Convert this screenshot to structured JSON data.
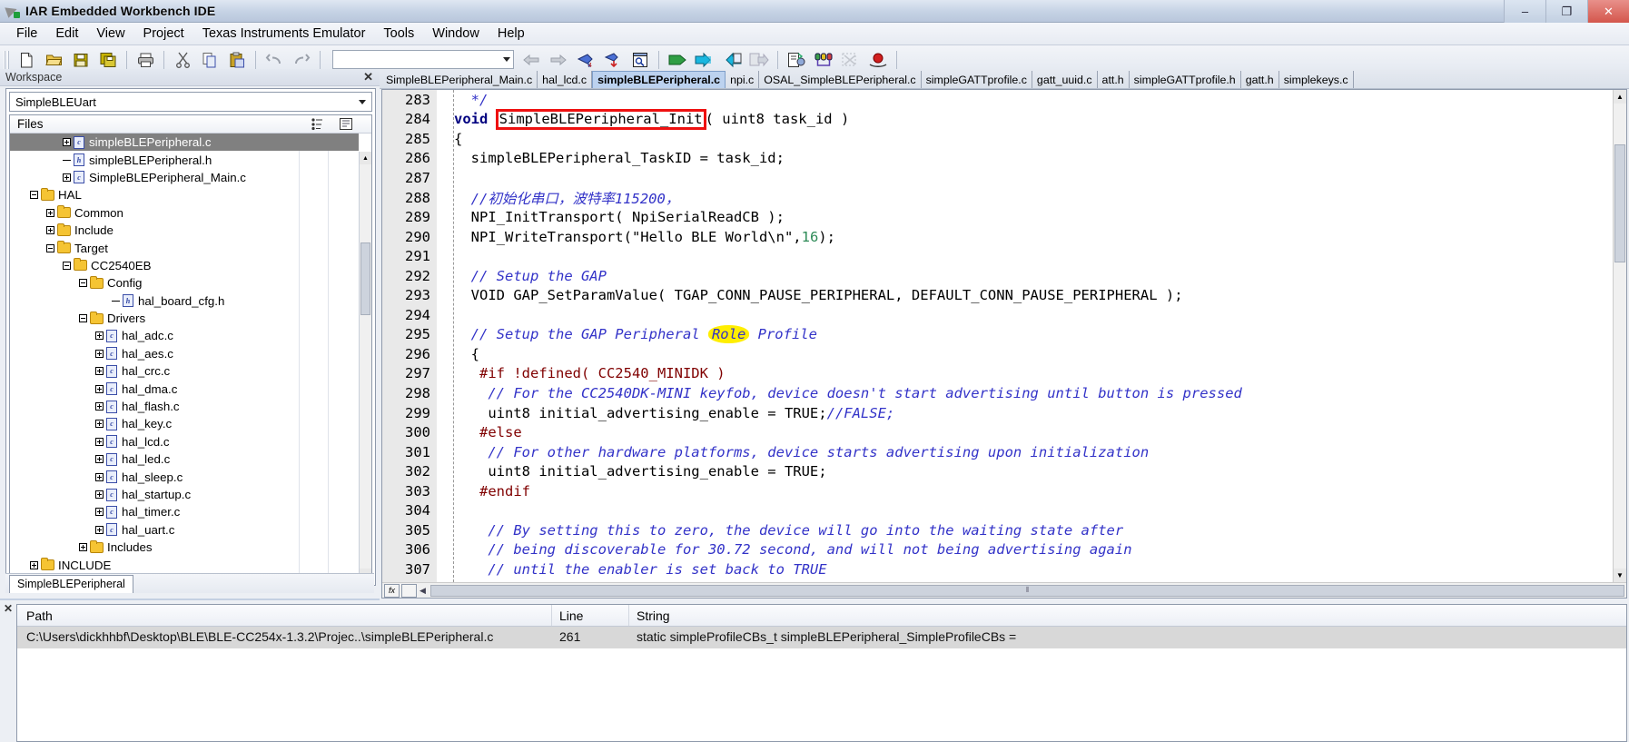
{
  "window": {
    "title": "IAR Embedded Workbench IDE",
    "icon": "app-icon",
    "buttons": {
      "minimize": "–",
      "maximize": "❐",
      "close": "✕"
    }
  },
  "menubar": {
    "items": [
      "File",
      "Edit",
      "View",
      "Project",
      "Texas Instruments Emulator",
      "Tools",
      "Window",
      "Help"
    ]
  },
  "toolbar": {
    "combo_value": "",
    "buttons": [
      "new-document-icon",
      "open-folder-icon",
      "save-icon",
      "save-all-icon",
      "print-icon",
      "cut-icon",
      "copy-icon",
      "paste-icon",
      "undo-icon",
      "redo-icon"
    ],
    "buttons2": [
      "navigate-back-icon",
      "navigate-forward-icon",
      "bookmark-toggle-icon",
      "bookmark-next-icon",
      "find-in-files-icon",
      "compile-icon",
      "make-icon",
      "stop-build-icon",
      "debug-icon",
      "debug-without-download-icon",
      "step-config-icon",
      "breakpoints-icon",
      "toggle-breakpoint-icon",
      "record-icon"
    ]
  },
  "workspace": {
    "header_title": "Workspace",
    "close_label": "✕",
    "project_combo": "SimpleBLEUart",
    "files_column": "Files",
    "footer_tab": "SimpleBLEPeripheral",
    "tree": [
      {
        "label": "simpleBLEPeripheral.c",
        "indent": 3,
        "icon": "c-file-icon",
        "expander": "plus",
        "selected": true
      },
      {
        "label": "simpleBLEPeripheral.h",
        "indent": 3,
        "icon": "h-file-icon",
        "expander": "none",
        "selected": false
      },
      {
        "label": "SimpleBLEPeripheral_Main.c",
        "indent": 3,
        "icon": "c-file-icon",
        "expander": "plus",
        "selected": false
      },
      {
        "label": "HAL",
        "indent": 1,
        "icon": "folder-icon",
        "expander": "minus",
        "selected": false
      },
      {
        "label": "Common",
        "indent": 2,
        "icon": "folder-icon",
        "expander": "plus",
        "selected": false
      },
      {
        "label": "Include",
        "indent": 2,
        "icon": "folder-icon",
        "expander": "plus",
        "selected": false
      },
      {
        "label": "Target",
        "indent": 2,
        "icon": "folder-icon",
        "expander": "minus",
        "selected": false
      },
      {
        "label": "CC2540EB",
        "indent": 3,
        "icon": "folder-icon",
        "expander": "minus",
        "selected": false
      },
      {
        "label": "Config",
        "indent": 4,
        "icon": "folder-icon",
        "expander": "minus",
        "selected": false
      },
      {
        "label": "hal_board_cfg.h",
        "indent": 6,
        "icon": "h-file-icon",
        "expander": "none",
        "selected": false
      },
      {
        "label": "Drivers",
        "indent": 4,
        "icon": "folder-icon",
        "expander": "minus",
        "selected": false
      },
      {
        "label": "hal_adc.c",
        "indent": 5,
        "icon": "c-file-icon",
        "expander": "plus",
        "selected": false
      },
      {
        "label": "hal_aes.c",
        "indent": 5,
        "icon": "c-file-icon",
        "expander": "plus",
        "selected": false
      },
      {
        "label": "hal_crc.c",
        "indent": 5,
        "icon": "c-file-icon",
        "expander": "plus",
        "selected": false
      },
      {
        "label": "hal_dma.c",
        "indent": 5,
        "icon": "c-file-icon",
        "expander": "plus",
        "selected": false
      },
      {
        "label": "hal_flash.c",
        "indent": 5,
        "icon": "c-file-icon",
        "expander": "plus",
        "selected": false
      },
      {
        "label": "hal_key.c",
        "indent": 5,
        "icon": "c-file-icon",
        "expander": "plus",
        "selected": false
      },
      {
        "label": "hal_lcd.c",
        "indent": 5,
        "icon": "c-file-icon",
        "expander": "plus",
        "selected": false
      },
      {
        "label": "hal_led.c",
        "indent": 5,
        "icon": "c-file-icon",
        "expander": "plus",
        "selected": false
      },
      {
        "label": "hal_sleep.c",
        "indent": 5,
        "icon": "c-file-icon",
        "expander": "plus",
        "selected": false
      },
      {
        "label": "hal_startup.c",
        "indent": 5,
        "icon": "c-file-icon",
        "expander": "plus",
        "selected": false
      },
      {
        "label": "hal_timer.c",
        "indent": 5,
        "icon": "c-file-icon",
        "expander": "plus",
        "selected": false
      },
      {
        "label": "hal_uart.c",
        "indent": 5,
        "icon": "c-file-icon",
        "expander": "plus",
        "selected": false
      },
      {
        "label": "Includes",
        "indent": 4,
        "icon": "folder-icon",
        "expander": "plus",
        "selected": false
      },
      {
        "label": "INCLUDE",
        "indent": 1,
        "icon": "folder-icon",
        "expander": "plus",
        "selected": false
      }
    ]
  },
  "editor": {
    "tabs": [
      {
        "label": "SimpleBLEPeripheral_Main.c",
        "active": false
      },
      {
        "label": "hal_lcd.c",
        "active": false
      },
      {
        "label": "simpleBLEPeripheral.c",
        "active": true
      },
      {
        "label": "npi.c",
        "active": false
      },
      {
        "label": "OSAL_SimpleBLEPeripheral.c",
        "active": false
      },
      {
        "label": "simpleGATTprofile.c",
        "active": false
      },
      {
        "label": "gatt_uuid.c",
        "active": false
      },
      {
        "label": "att.h",
        "active": false
      },
      {
        "label": "simpleGATTprofile.h",
        "active": false
      },
      {
        "label": "gatt.h",
        "active": false
      },
      {
        "label": "simplekeys.c",
        "active": false
      }
    ],
    "lines": [
      {
        "num": "283",
        "tokens": [
          {
            "t": "  */",
            "c": "c-com"
          }
        ]
      },
      {
        "num": "284",
        "tokens": [
          {
            "t": "void ",
            "c": "c-kw"
          },
          {
            "t": "SimpleBLEPeripheral_Init",
            "c": "c-plain",
            "box": true
          },
          {
            "t": "( uint8 task_id )",
            "c": "c-plain"
          }
        ]
      },
      {
        "num": "285",
        "tokens": [
          {
            "t": "{",
            "c": "c-plain"
          }
        ]
      },
      {
        "num": "286",
        "tokens": [
          {
            "t": "  simpleBLEPeripheral_TaskID = task_id;",
            "c": "c-plain"
          }
        ]
      },
      {
        "num": "287",
        "tokens": [
          {
            "t": "",
            "c": "c-plain"
          }
        ]
      },
      {
        "num": "288",
        "tokens": [
          {
            "t": "  //初始化串口，波特率115200，",
            "c": "c-com"
          }
        ]
      },
      {
        "num": "289",
        "tokens": [
          {
            "t": "  NPI_InitTransport( NpiSerialReadCB );",
            "c": "c-plain"
          }
        ]
      },
      {
        "num": "290",
        "tokens": [
          {
            "t": "  NPI_WriteTransport(\"Hello BLE World\\n\",",
            "c": "c-plain"
          },
          {
            "t": "16",
            "c": "c-num"
          },
          {
            "t": ");",
            "c": "c-plain"
          }
        ]
      },
      {
        "num": "291",
        "tokens": [
          {
            "t": "",
            "c": "c-plain"
          }
        ]
      },
      {
        "num": "292",
        "tokens": [
          {
            "t": "  // Setup the GAP",
            "c": "c-com"
          }
        ]
      },
      {
        "num": "293",
        "tokens": [
          {
            "t": "  VOID GAP_SetParamValue( TGAP_CONN_PAUSE_PERIPHERAL, DEFAULT_CONN_PAUSE_PERIPHERAL );",
            "c": "c-plain"
          }
        ]
      },
      {
        "num": "294",
        "tokens": [
          {
            "t": "",
            "c": "c-plain"
          }
        ]
      },
      {
        "num": "295",
        "tokens": [
          {
            "t": "  // Setup the GAP Peripheral ",
            "c": "c-com"
          },
          {
            "t": "Role",
            "c": "c-com",
            "highlight": true
          },
          {
            "t": " Profile",
            "c": "c-com"
          }
        ]
      },
      {
        "num": "296",
        "tokens": [
          {
            "t": "  {",
            "c": "c-plain"
          }
        ]
      },
      {
        "num": "297",
        "tokens": [
          {
            "t": "   #if !defined( CC2540_MINIDK )",
            "c": "c-pp"
          }
        ]
      },
      {
        "num": "298",
        "tokens": [
          {
            "t": "    // For the CC2540DK-MINI keyfob, device doesn't start advertising until button is pressed",
            "c": "c-com"
          }
        ]
      },
      {
        "num": "299",
        "tokens": [
          {
            "t": "    uint8 initial_advertising_enable = TRUE;",
            "c": "c-plain"
          },
          {
            "t": "//FALSE;",
            "c": "c-com"
          }
        ]
      },
      {
        "num": "300",
        "tokens": [
          {
            "t": "   #else",
            "c": "c-pp"
          }
        ]
      },
      {
        "num": "301",
        "tokens": [
          {
            "t": "    // For other hardware platforms, device starts advertising upon initialization",
            "c": "c-com"
          }
        ]
      },
      {
        "num": "302",
        "tokens": [
          {
            "t": "    uint8 initial_advertising_enable = TRUE;",
            "c": "c-plain"
          }
        ]
      },
      {
        "num": "303",
        "tokens": [
          {
            "t": "   #endif",
            "c": "c-pp"
          }
        ]
      },
      {
        "num": "304",
        "tokens": [
          {
            "t": "",
            "c": "c-plain"
          }
        ]
      },
      {
        "num": "305",
        "tokens": [
          {
            "t": "    // By setting this to zero, the device will go into the waiting state after",
            "c": "c-com"
          }
        ]
      },
      {
        "num": "306",
        "tokens": [
          {
            "t": "    // being discoverable for 30.72 second, and will not being advertising again",
            "c": "c-com"
          }
        ]
      },
      {
        "num": "307",
        "tokens": [
          {
            "t": "    // until the enabler is set back to TRUE",
            "c": "c-com"
          }
        ]
      }
    ],
    "hscroll_grip": "⦀",
    "fx_button": "fx"
  },
  "findpanel": {
    "close_label": "✕",
    "columns": [
      "Path",
      "Line",
      "String"
    ],
    "rows": [
      {
        "path": "C:\\Users\\dickhhbf\\Desktop\\BLE\\BLE-CC254x-1.3.2\\Projec..\\simpleBLEPeripheral.c",
        "line": "261",
        "string": "static simpleProfileCBs_t simpleBLEPeripheral_SimpleProfileCBs ="
      }
    ]
  },
  "colors": {
    "accent": "#bcd2ef",
    "selection": "#808080",
    "highlight_red": "#ee1111",
    "highlight_yellow": "#ffee00",
    "comment_blue": "#3333c8",
    "keyword_navy": "#000080",
    "preprocessor_maroon": "#800000",
    "number_green": "#2e8b57"
  }
}
